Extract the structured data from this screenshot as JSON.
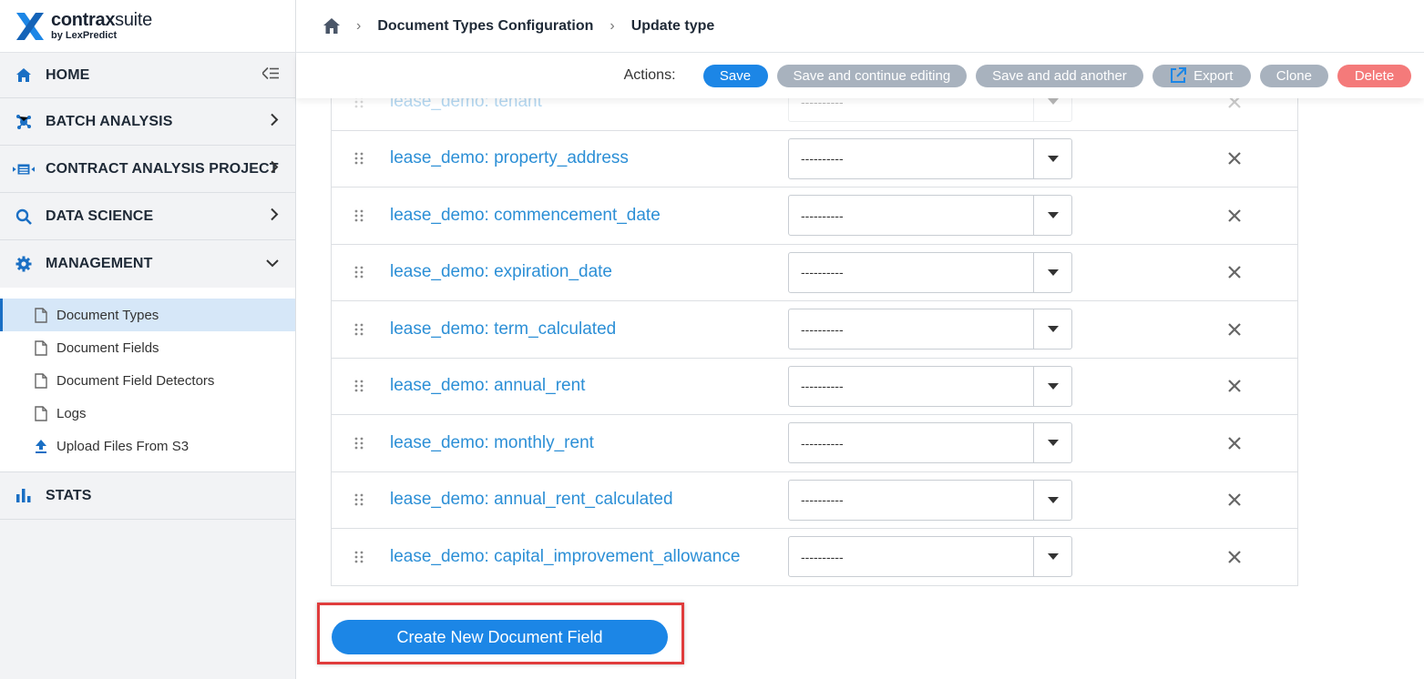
{
  "brand": {
    "name_bold": "contrax",
    "name_rest": "suite",
    "sub": "by LexPredict",
    "accent": "#1c86e6"
  },
  "breadcrumb": {
    "home_icon": "home-icon",
    "items": [
      "Document Types Configuration",
      "Update type"
    ],
    "separator": "›"
  },
  "sidebar": {
    "items": [
      {
        "label": "HOME",
        "icon": "home-icon"
      },
      {
        "label": "BATCH ANALYSIS",
        "icon": "batch-icon"
      },
      {
        "label": "CONTRACT ANALYSIS PROJECT",
        "icon": "project-icon"
      },
      {
        "label": "DATA SCIENCE",
        "icon": "search-icon"
      },
      {
        "label": "MANAGEMENT",
        "icon": "gear-icon"
      },
      {
        "label": "STATS",
        "icon": "bar-chart-icon"
      }
    ],
    "management_sub": [
      {
        "label": "Document Types",
        "active": true
      },
      {
        "label": "Document Fields"
      },
      {
        "label": "Document Field Detectors"
      },
      {
        "label": "Logs"
      },
      {
        "label": "Upload Files From S3"
      }
    ]
  },
  "actions": {
    "label": "Actions:",
    "save": "Save",
    "save_continue": "Save and continue editing",
    "save_add": "Save and add another",
    "export": "Export",
    "clone": "Clone",
    "delete": "Delete"
  },
  "fields": [
    {
      "name": "lease_demo: tenant",
      "value": "----------"
    },
    {
      "name": "lease_demo: property_address",
      "value": "----------"
    },
    {
      "name": "lease_demo: commencement_date",
      "value": "----------"
    },
    {
      "name": "lease_demo: expiration_date",
      "value": "----------"
    },
    {
      "name": "lease_demo: term_calculated",
      "value": "----------"
    },
    {
      "name": "lease_demo: annual_rent",
      "value": "----------"
    },
    {
      "name": "lease_demo: monthly_rent",
      "value": "----------"
    },
    {
      "name": "lease_demo: annual_rent_calculated",
      "value": "----------"
    },
    {
      "name": "lease_demo: capital_improvement_allowance",
      "value": "----------"
    }
  ],
  "create_button": "Create New Document Field"
}
